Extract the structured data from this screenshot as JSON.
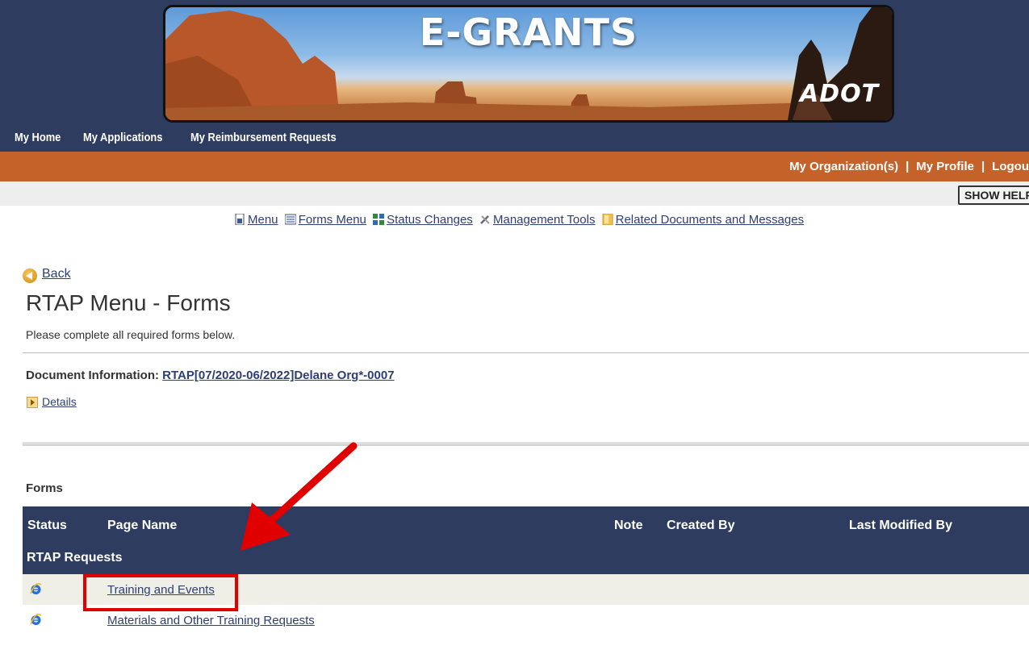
{
  "banner": {
    "title": "E-GRANTS",
    "logo": "ADOT"
  },
  "topnav": [
    "My Home",
    "My Applications",
    "My Reimbursement Requests"
  ],
  "usernav": {
    "organizations": "My Organization(s)",
    "profile": "My Profile",
    "logout": "Logou",
    "separator": "|"
  },
  "show_help": "SHOW HELP",
  "toolbar": {
    "menu": "Menu",
    "forms_menu": "Forms Menu",
    "status_changes": "Status Changes",
    "management_tools": "Management Tools",
    "related_documents": "Related Documents and Messages"
  },
  "back": "Back",
  "page_title": "RTAP Menu - Forms",
  "instructions": "Please complete all required forms below.",
  "document_info": {
    "label": "Document Information:",
    "value": "RTAP[07/2020-06/2022]Delane Org*-0007"
  },
  "details": "Details",
  "forms": {
    "heading": "Forms",
    "columns": [
      "Status",
      "Page Name",
      "Note",
      "Created By",
      "Last Modified By"
    ],
    "group": "RTAP Requests",
    "rows": [
      {
        "status_icon": "ie-icon",
        "page_name": "Training and Events"
      },
      {
        "status_icon": "ie-icon",
        "page_name": "Materials and Other Training Requests"
      }
    ]
  },
  "colors": {
    "header_navy": "#2e3c5f",
    "orange_bar": "#c4622a",
    "link": "#2d3f73",
    "annotation_red": "#e00000"
  },
  "icons": [
    "menu-icon",
    "forms-menu-icon",
    "status-changes-icon",
    "management-tools-icon",
    "related-documents-icon",
    "back-icon",
    "details-icon",
    "ie-icon"
  ]
}
